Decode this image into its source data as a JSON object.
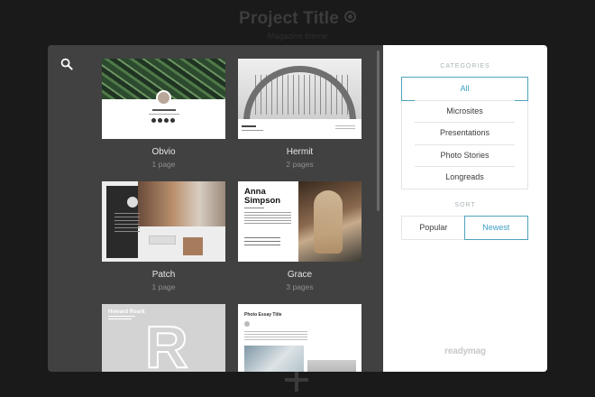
{
  "background": {
    "project_title": "Project Title",
    "project_subtitle": "Magazine theme"
  },
  "templates": [
    {
      "title": "Obvio",
      "pages": "1 page"
    },
    {
      "title": "Hermit",
      "pages": "2 pages"
    },
    {
      "title": "Patch",
      "pages": "1 page"
    },
    {
      "title": "Grace",
      "pages": "3 pages"
    },
    {
      "title": "Howard Roark",
      "pages": ""
    },
    {
      "title": "Photo Essay",
      "pages": ""
    }
  ],
  "thumb_text": {
    "grace_name": "Anna Simpson",
    "roark_title": "Howard Roark",
    "roark_letter": "R",
    "essay_head": "Photo Essay Title"
  },
  "sidebar": {
    "categories_label": "CATEGORIES",
    "categories": [
      "All",
      "Microsites",
      "Presentations",
      "Photo Stories",
      "Longreads"
    ],
    "active_category": "All",
    "sort_label": "SORT",
    "sort_options": [
      "Popular",
      "Newest"
    ],
    "active_sort": "Newest",
    "logo": "readymag"
  },
  "colors": {
    "accent": "#3c9fc0",
    "left_panel": "#414141",
    "backdrop": "#1a1a1a"
  },
  "icons": [
    "search-icon",
    "gear-icon",
    "add-icon"
  ]
}
